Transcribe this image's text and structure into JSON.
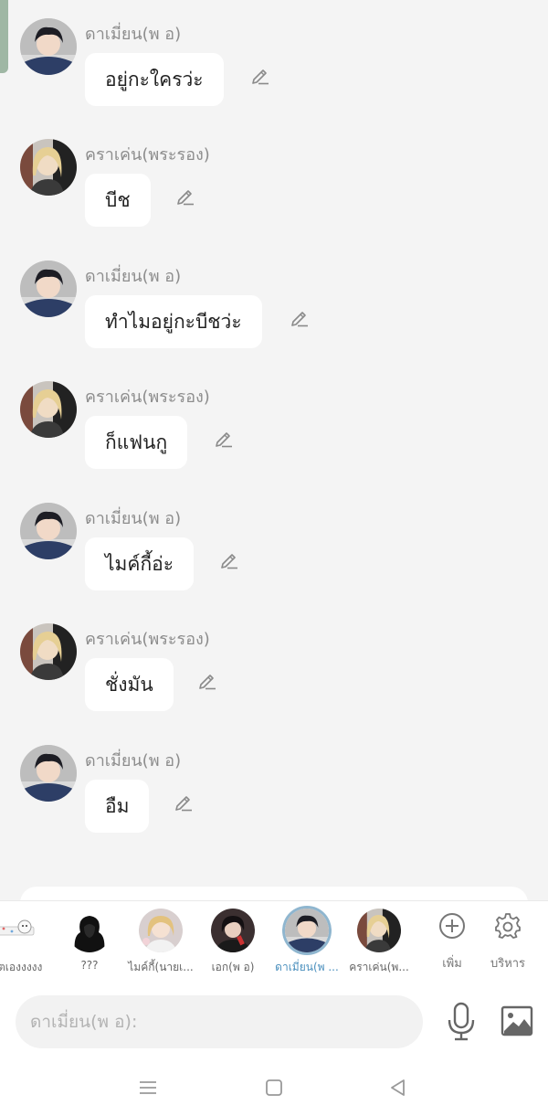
{
  "messages": [
    {
      "sender": "ดาเมี่ยน(พ อ)",
      "text": "อยู่กะใครว่ะ",
      "avatar": "damian-avatar"
    },
    {
      "sender": "คราเค่น(พระรอง)",
      "text": "บีช",
      "avatar": "kraken-avatar"
    },
    {
      "sender": "ดาเมี่ยน(พ อ)",
      "text": "ทำไมอยู่กะบีชว่ะ",
      "avatar": "damian-avatar"
    },
    {
      "sender": "คราเค่น(พระรอง)",
      "text": "ก็แฟนกู",
      "avatar": "kraken-avatar"
    },
    {
      "sender": "ดาเมี่ยน(พ อ)",
      "text": "ไมค์กี้อ่ะ",
      "avatar": "damian-avatar"
    },
    {
      "sender": "คราเค่น(พระรอง)",
      "text": "ชั่งมัน",
      "avatar": "kraken-avatar"
    },
    {
      "sender": "ดาเมี่ยน(พ อ)",
      "text": "อืม",
      "avatar": "damian-avatar"
    }
  ],
  "characters": [
    {
      "name": "ตเองงงงง",
      "icon": "sticker-avatar"
    },
    {
      "name": "???",
      "icon": "silhouette-avatar"
    },
    {
      "name": "ไมค์กี้(นายเ...",
      "icon": "mikey-avatar"
    },
    {
      "name": "เอก(พ อ)",
      "icon": "ek-avatar"
    },
    {
      "name": "ดาเมี่ยน(พ ...",
      "icon": "damian-avatar",
      "selected": true
    },
    {
      "name": "คราเค่น(พ...",
      "icon": "kraken-avatar"
    }
  ],
  "tools": {
    "add_label": "เพิ่ม",
    "manage_label": "บริหาร"
  },
  "input": {
    "placeholder": "ดาเมี่ยน(พ อ):"
  },
  "colors": {
    "background": "#f4f4f4",
    "bubble": "#ffffff",
    "selected_accent": "#4a8fbd",
    "sender_text": "#8d8d8d"
  }
}
